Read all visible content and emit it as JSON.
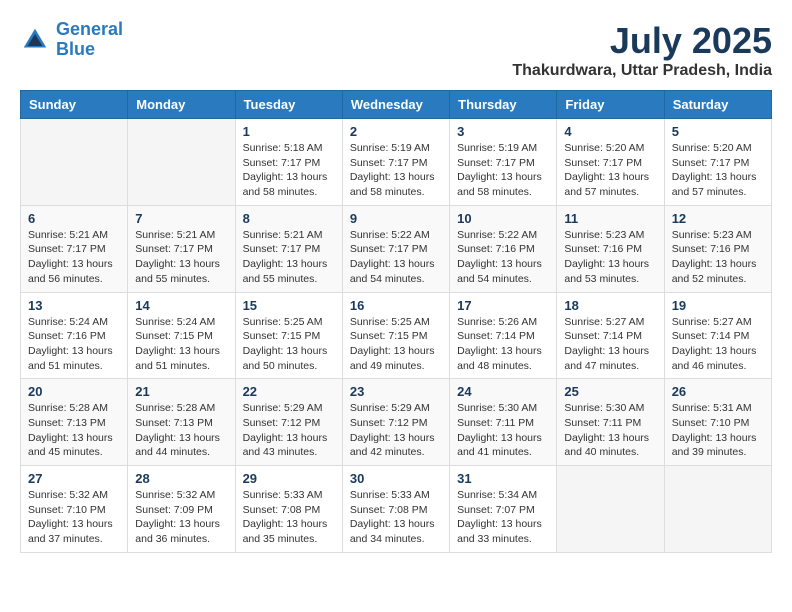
{
  "header": {
    "logo_line1": "General",
    "logo_line2": "Blue",
    "title": "July 2025",
    "subtitle": "Thakurdwara, Uttar Pradesh, India"
  },
  "weekdays": [
    "Sunday",
    "Monday",
    "Tuesday",
    "Wednesday",
    "Thursday",
    "Friday",
    "Saturday"
  ],
  "weeks": [
    [
      {
        "day": "",
        "info": ""
      },
      {
        "day": "",
        "info": ""
      },
      {
        "day": "1",
        "info": "Sunrise: 5:18 AM\nSunset: 7:17 PM\nDaylight: 13 hours and 58 minutes."
      },
      {
        "day": "2",
        "info": "Sunrise: 5:19 AM\nSunset: 7:17 PM\nDaylight: 13 hours and 58 minutes."
      },
      {
        "day": "3",
        "info": "Sunrise: 5:19 AM\nSunset: 7:17 PM\nDaylight: 13 hours and 58 minutes."
      },
      {
        "day": "4",
        "info": "Sunrise: 5:20 AM\nSunset: 7:17 PM\nDaylight: 13 hours and 57 minutes."
      },
      {
        "day": "5",
        "info": "Sunrise: 5:20 AM\nSunset: 7:17 PM\nDaylight: 13 hours and 57 minutes."
      }
    ],
    [
      {
        "day": "6",
        "info": "Sunrise: 5:21 AM\nSunset: 7:17 PM\nDaylight: 13 hours and 56 minutes."
      },
      {
        "day": "7",
        "info": "Sunrise: 5:21 AM\nSunset: 7:17 PM\nDaylight: 13 hours and 55 minutes."
      },
      {
        "day": "8",
        "info": "Sunrise: 5:21 AM\nSunset: 7:17 PM\nDaylight: 13 hours and 55 minutes."
      },
      {
        "day": "9",
        "info": "Sunrise: 5:22 AM\nSunset: 7:17 PM\nDaylight: 13 hours and 54 minutes."
      },
      {
        "day": "10",
        "info": "Sunrise: 5:22 AM\nSunset: 7:16 PM\nDaylight: 13 hours and 54 minutes."
      },
      {
        "day": "11",
        "info": "Sunrise: 5:23 AM\nSunset: 7:16 PM\nDaylight: 13 hours and 53 minutes."
      },
      {
        "day": "12",
        "info": "Sunrise: 5:23 AM\nSunset: 7:16 PM\nDaylight: 13 hours and 52 minutes."
      }
    ],
    [
      {
        "day": "13",
        "info": "Sunrise: 5:24 AM\nSunset: 7:16 PM\nDaylight: 13 hours and 51 minutes."
      },
      {
        "day": "14",
        "info": "Sunrise: 5:24 AM\nSunset: 7:15 PM\nDaylight: 13 hours and 51 minutes."
      },
      {
        "day": "15",
        "info": "Sunrise: 5:25 AM\nSunset: 7:15 PM\nDaylight: 13 hours and 50 minutes."
      },
      {
        "day": "16",
        "info": "Sunrise: 5:25 AM\nSunset: 7:15 PM\nDaylight: 13 hours and 49 minutes."
      },
      {
        "day": "17",
        "info": "Sunrise: 5:26 AM\nSunset: 7:14 PM\nDaylight: 13 hours and 48 minutes."
      },
      {
        "day": "18",
        "info": "Sunrise: 5:27 AM\nSunset: 7:14 PM\nDaylight: 13 hours and 47 minutes."
      },
      {
        "day": "19",
        "info": "Sunrise: 5:27 AM\nSunset: 7:14 PM\nDaylight: 13 hours and 46 minutes."
      }
    ],
    [
      {
        "day": "20",
        "info": "Sunrise: 5:28 AM\nSunset: 7:13 PM\nDaylight: 13 hours and 45 minutes."
      },
      {
        "day": "21",
        "info": "Sunrise: 5:28 AM\nSunset: 7:13 PM\nDaylight: 13 hours and 44 minutes."
      },
      {
        "day": "22",
        "info": "Sunrise: 5:29 AM\nSunset: 7:12 PM\nDaylight: 13 hours and 43 minutes."
      },
      {
        "day": "23",
        "info": "Sunrise: 5:29 AM\nSunset: 7:12 PM\nDaylight: 13 hours and 42 minutes."
      },
      {
        "day": "24",
        "info": "Sunrise: 5:30 AM\nSunset: 7:11 PM\nDaylight: 13 hours and 41 minutes."
      },
      {
        "day": "25",
        "info": "Sunrise: 5:30 AM\nSunset: 7:11 PM\nDaylight: 13 hours and 40 minutes."
      },
      {
        "day": "26",
        "info": "Sunrise: 5:31 AM\nSunset: 7:10 PM\nDaylight: 13 hours and 39 minutes."
      }
    ],
    [
      {
        "day": "27",
        "info": "Sunrise: 5:32 AM\nSunset: 7:10 PM\nDaylight: 13 hours and 37 minutes."
      },
      {
        "day": "28",
        "info": "Sunrise: 5:32 AM\nSunset: 7:09 PM\nDaylight: 13 hours and 36 minutes."
      },
      {
        "day": "29",
        "info": "Sunrise: 5:33 AM\nSunset: 7:08 PM\nDaylight: 13 hours and 35 minutes."
      },
      {
        "day": "30",
        "info": "Sunrise: 5:33 AM\nSunset: 7:08 PM\nDaylight: 13 hours and 34 minutes."
      },
      {
        "day": "31",
        "info": "Sunrise: 5:34 AM\nSunset: 7:07 PM\nDaylight: 13 hours and 33 minutes."
      },
      {
        "day": "",
        "info": ""
      },
      {
        "day": "",
        "info": ""
      }
    ]
  ]
}
